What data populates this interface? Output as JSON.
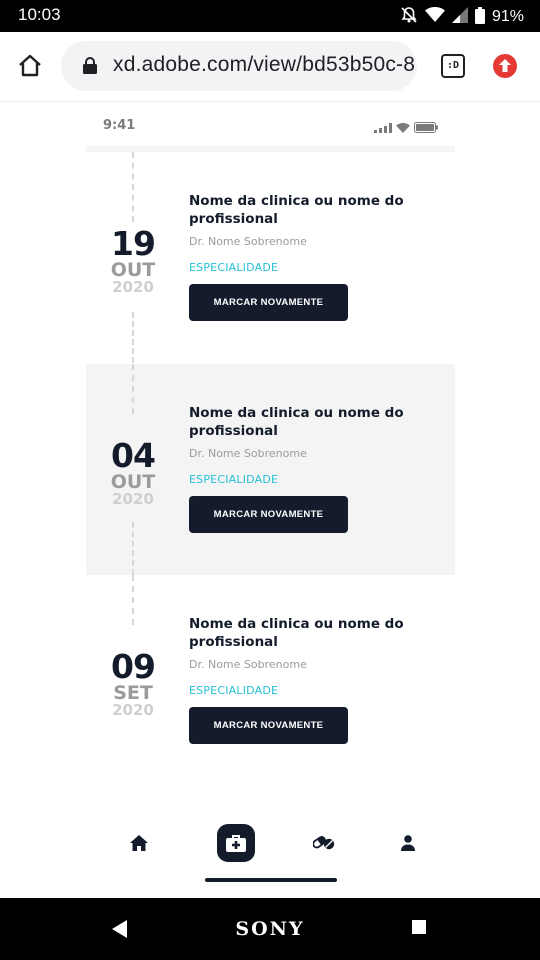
{
  "status_bar": {
    "time": "10:03",
    "battery": "91%"
  },
  "browser": {
    "url": "xd.adobe.com/view/bd53b50c-8",
    "tabs_label": ":D"
  },
  "prototype_status": {
    "time": "9:41"
  },
  "appointments": [
    {
      "day": "19",
      "month": "OUT",
      "year": "2020",
      "clinic": "Nome da clinica ou nome do profissional",
      "doctor": "Dr. Nome Sobrenome",
      "specialty": "ESPECIALIDADE",
      "button": "MARCAR NOVAMENTE"
    },
    {
      "day": "04",
      "month": "OUT",
      "year": "2020",
      "clinic": "Nome da clinica ou nome do profissional",
      "doctor": "Dr. Nome Sobrenome",
      "specialty": "ESPECIALIDADE",
      "button": "MARCAR NOVAMENTE"
    },
    {
      "day": "09",
      "month": "SET",
      "year": "2020",
      "clinic": "Nome da clinica ou nome do profissional",
      "doctor": "Dr. Nome Sobrenome",
      "specialty": "ESPECIALIDADE",
      "button": "MARCAR NOVAMENTE"
    }
  ],
  "bottom_nav": {
    "items": [
      "home-icon",
      "medical-kit-icon",
      "pills-icon",
      "profile-icon"
    ],
    "active": "medical-kit-icon"
  },
  "android_nav": {
    "brand": "SONY"
  },
  "colors": {
    "primary": "#141c2c",
    "accent": "#25c0d6",
    "muted": "#9b9b9b",
    "alt_row": "#f4f4f4"
  }
}
